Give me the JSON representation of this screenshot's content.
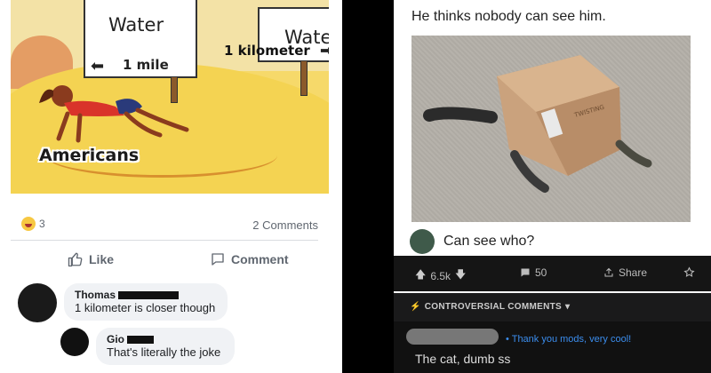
{
  "facebook_post": {
    "meme": {
      "sign_left_title": "Water",
      "sign_left_distance": "1 mile",
      "sign_right_title": "Water",
      "sign_right_distance": "1 kilometer",
      "caption": "Americans"
    },
    "reactions": {
      "count": "3",
      "icon": "haha-reaction-icon"
    },
    "comments_count": "2 Comments",
    "actions": {
      "like": "Like",
      "comment": "Comment"
    },
    "comments": [
      {
        "author": "Thomas",
        "text": "1 kilometer is closer though"
      },
      {
        "author": "Gio",
        "text": "That's literally the joke"
      }
    ]
  },
  "reddit_post": {
    "title": "He thinks nobody can see him.",
    "reply": "Can see who?",
    "bar": {
      "votes": "6.5k",
      "comments": "50",
      "share": "Share"
    },
    "section_label": "CONTROVERSIAL COMMENTS",
    "comment": {
      "flair": "Thank you mods, very cool!",
      "text": "The cat, dumb ss"
    },
    "box_label": "TWISTING"
  },
  "colors": {
    "facebook_text": "#1c1e21",
    "facebook_muted": "#606770",
    "reddit_dark": "#151515",
    "reddit_flair": "#3b8ded",
    "sand": "#f4d352"
  }
}
